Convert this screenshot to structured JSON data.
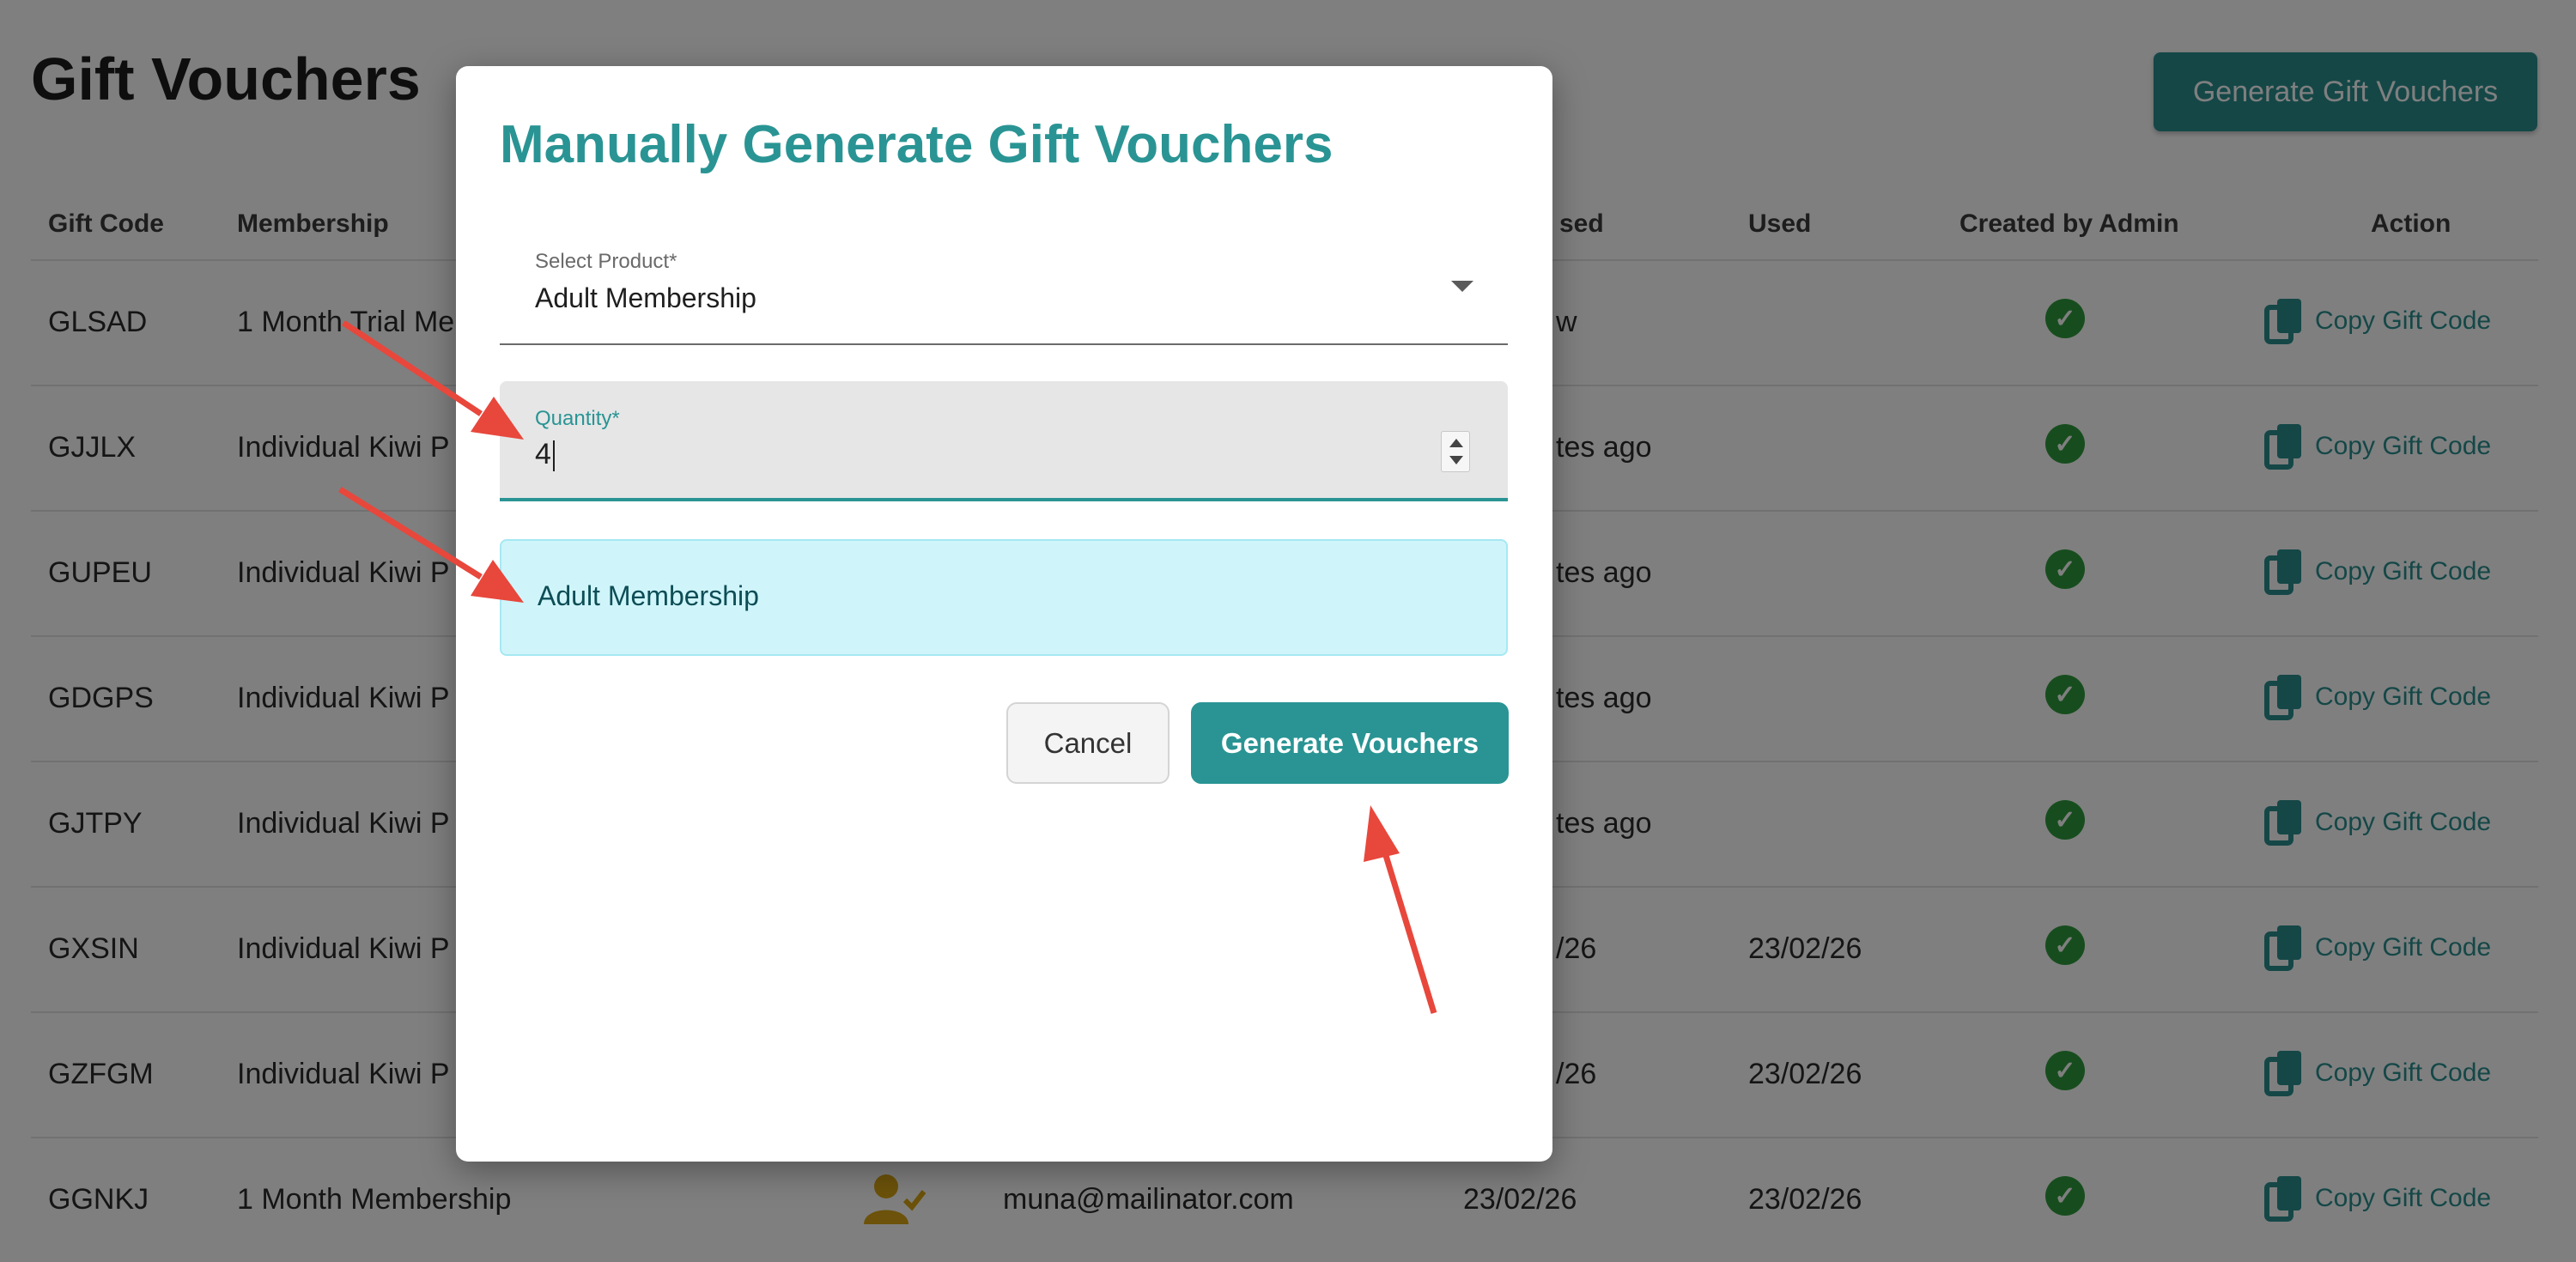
{
  "page": {
    "title": "Gift Vouchers",
    "generate_button": "Generate Gift Vouchers",
    "columns": [
      "Gift Code",
      "Membership",
      "sed",
      "Used",
      "Created by Admin",
      "Action"
    ],
    "rows": [
      {
        "code": "GLSAD",
        "membership": "1 Month Trial Me",
        "date": "w",
        "used": ""
      },
      {
        "code": "GJJLX",
        "membership": "Individual Kiwi P",
        "date": "tes ago",
        "used": ""
      },
      {
        "code": "GUPEU",
        "membership": "Individual Kiwi P",
        "date": "tes ago",
        "used": ""
      },
      {
        "code": "GDGPS",
        "membership": "Individual Kiwi P",
        "date": "tes ago",
        "used": ""
      },
      {
        "code": "GJTPY",
        "membership": "Individual Kiwi P",
        "date": "tes ago",
        "used": ""
      },
      {
        "code": "GXSIN",
        "membership": "Individual Kiwi P",
        "date": "/26",
        "used": "23/02/26"
      },
      {
        "code": "GZFGM",
        "membership": "Individual Kiwi P",
        "date": "/26",
        "used": "23/02/26"
      },
      {
        "code": "GGNKJ",
        "membership": "1 Month Membership",
        "email": "muna@mailinator.com",
        "date": "23/02/26",
        "used": "23/02/26"
      }
    ],
    "copy_label": "Copy Gift Code"
  },
  "modal": {
    "title": "Manually Generate Gift Vouchers",
    "select_label": "Select Product*",
    "select_value": "Adult Membership",
    "quantity_label": "Quantity*",
    "quantity_value": "4",
    "info_text": "Adult Membership",
    "cancel_label": "Cancel",
    "generate_label": "Generate Vouchers"
  },
  "colors": {
    "accent": "#2a9494",
    "info_bg": "#cff5fa",
    "annotation_arrow": "#e8473c",
    "check": "#2e9b3c"
  }
}
